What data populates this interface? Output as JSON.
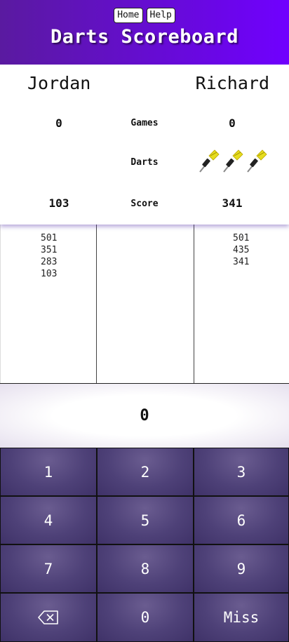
{
  "nav": {
    "home_label": "Home",
    "help_label": "Help"
  },
  "title": "Darts Scoreboard",
  "players": [
    {
      "name": "Jordan",
      "games": "0",
      "score": "103",
      "history": [
        "501",
        "351",
        "283",
        "103"
      ]
    },
    {
      "name": "Richard",
      "games": "0",
      "score": "341",
      "history": [
        "501",
        "435",
        "341"
      ]
    }
  ],
  "labels": {
    "games": "Games",
    "darts": "Darts",
    "score": "Score"
  },
  "darts_icons": [
    "dart-icon",
    "dart-icon",
    "dart-icon"
  ],
  "display_value": "0",
  "keypad": {
    "k1": "1",
    "k2": "2",
    "k3": "3",
    "k4": "4",
    "k5": "5",
    "k6": "6",
    "k7": "7",
    "k8": "8",
    "k9": "9",
    "backspace_icon": "backspace-icon",
    "k0": "0",
    "miss": "Miss"
  },
  "colors": {
    "header_start": "#5a1aa0",
    "header_end": "#7000ff",
    "key_bg": "#4e4178",
    "dart_yellow": "#e6dd1f"
  }
}
